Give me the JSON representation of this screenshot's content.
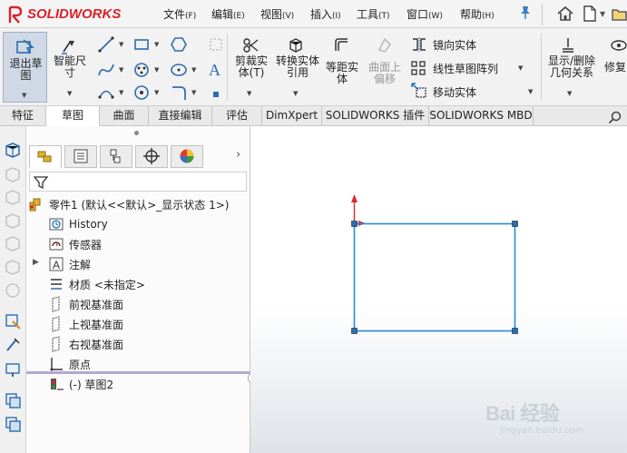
{
  "app": {
    "brand": "SOLIDWORKS",
    "accent": "#d8232a"
  },
  "menu": {
    "items": [
      {
        "label": "文件",
        "key": "(F)"
      },
      {
        "label": "编辑",
        "key": "(E)"
      },
      {
        "label": "视图",
        "key": "(V)"
      },
      {
        "label": "插入",
        "key": "(I)"
      },
      {
        "label": "工具",
        "key": "(T)"
      },
      {
        "label": "窗口",
        "key": "(W)"
      },
      {
        "label": "帮助",
        "key": "(H)"
      }
    ]
  },
  "commands": {
    "exit_sketch": "退出草图",
    "smart_dimension": "智能尺寸",
    "trim_entities": "剪裁实体(T)",
    "convert_entities": "转换实体引用",
    "offset_entities": "等距实体",
    "offset_on_surface": "曲面上偏移",
    "mirror_entities": "镜向实体",
    "linear_pattern": "线性草图阵列",
    "move_entities": "移动实体",
    "display_delete_relations": "显示/删除几何关系",
    "repair_sketch": "修复"
  },
  "tabs": [
    "特征",
    "草图",
    "曲面",
    "直接编辑",
    "评估",
    "DimXpert",
    "SOLIDWORKS 插件",
    "SOLIDWORKS MBD"
  ],
  "active_tab": "草图",
  "feature_tree": {
    "root": "零件1 (默认<<默认>_显示状态 1>)",
    "items": [
      {
        "label": "History",
        "icon": "history-icon"
      },
      {
        "label": "传感器",
        "icon": "sensor-icon"
      },
      {
        "label": "注解",
        "icon": "annotation-icon"
      },
      {
        "label": "材质 <未指定>",
        "icon": "material-icon"
      },
      {
        "label": "前视基准面",
        "icon": "plane-icon"
      },
      {
        "label": "上视基准面",
        "icon": "plane-icon"
      },
      {
        "label": "右视基准面",
        "icon": "plane-icon"
      },
      {
        "label": "原点",
        "icon": "origin-icon"
      },
      {
        "label": "(-) 草图2",
        "icon": "sketch-icon"
      }
    ]
  },
  "watermark": {
    "brand": "Bai 经验",
    "url": "jingyan.baidu.com"
  }
}
